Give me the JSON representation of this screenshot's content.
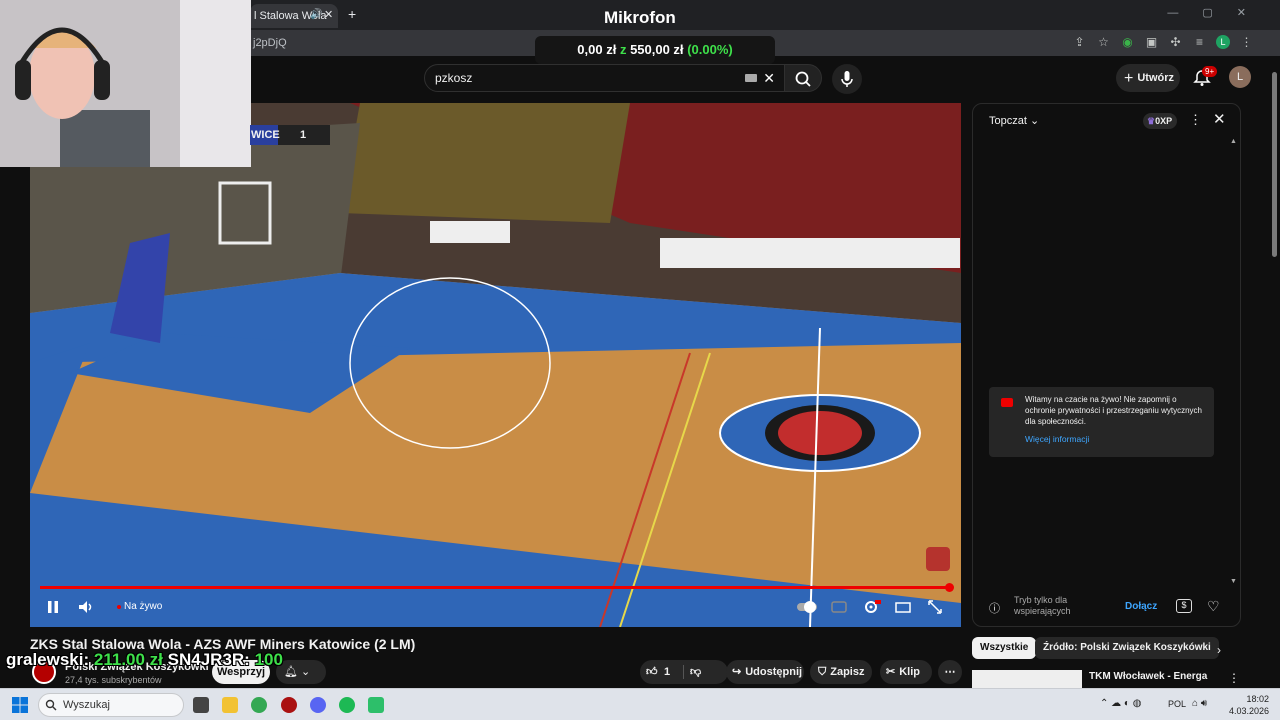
{
  "browser": {
    "tab_title": "l Stalowa Wola",
    "url_fragment": "j2pDjQ"
  },
  "overlay": {
    "mic_label": "Mikrofon",
    "goal": {
      "current": "0,00 zł",
      "sep": "z",
      "target": "550,00 zł",
      "percent": "(0.00%)"
    },
    "donor": {
      "name": "gralewski:",
      "amount1": "211.00 zł",
      "code": "SN4JR3R:",
      "amount2": "100"
    }
  },
  "youtube": {
    "search_value": "pzkosz",
    "create_label": "Utwórz",
    "notifications_badge": "9+",
    "avatar_letter": "L"
  },
  "player": {
    "score_team": "WICE",
    "score_value": "1",
    "live_label": "Na żywo",
    "progress": 0.995
  },
  "chat": {
    "title": "Topczat",
    "xp_label": "0XP",
    "welcome_text": "Witamy na czacie na żywo! Nie zapomnij o ochronie prywatności i przestrzeganiu wytycznych dla społeczności.",
    "welcome_link": "Więcej informacji",
    "footer_text_1": "Tryb tylko dla",
    "footer_text_2": "wspierających",
    "join_label": "Dołącz"
  },
  "video": {
    "title": "ZKS Stal Stalowa Wola - AZS AWF Miners Katowice (2 LM)",
    "channel_name": "Polski Związek Koszykówki",
    "subscribers": "27,4 tys. subskrybentów",
    "support_label": "Wesprzyj",
    "like_count": "1",
    "share_label": "Udostępnij",
    "save_label": "Zapisz",
    "clip_label": "Klip",
    "chip_all": "Wszystkie",
    "chip_source": "Źródło: Polski Związek Koszykówki",
    "related_title": "TKM Włocławek - Energa"
  },
  "taskbar": {
    "search_placeholder": "Wyszukaj",
    "language": "POL",
    "time": "18:02",
    "date": "4.03.2026"
  },
  "colors": {
    "accent_red": "#ee0000",
    "goal_green": "#3ee04a",
    "link_blue": "#3ea6ff"
  }
}
